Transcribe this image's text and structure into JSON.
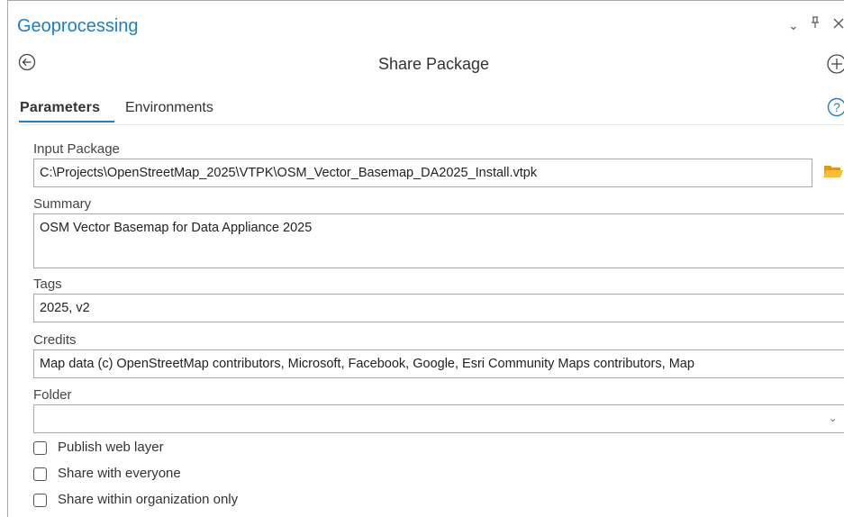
{
  "pane": {
    "title": "Geoprocessing",
    "window_controls": {
      "options_icon": "chevron-down-icon",
      "pin_icon": "pin-icon",
      "close_icon": "close-icon"
    }
  },
  "tool": {
    "title": "Share Package",
    "back_icon": "back-arrow-icon",
    "add_icon": "add-icon"
  },
  "tabs": [
    {
      "label": "Parameters",
      "active": true
    },
    {
      "label": "Environments",
      "active": false
    }
  ],
  "help_icon": "help-icon",
  "params": {
    "input_package": {
      "label": "Input Package",
      "value": "C:\\Projects\\OpenStreetMap_2025\\VTPK\\OSM_Vector_Basemap_DA2025_Install.vtpk",
      "browse_icon": "folder-icon"
    },
    "summary": {
      "label": "Summary",
      "value": "OSM Vector Basemap for Data Appliance 2025"
    },
    "tags": {
      "label": "Tags",
      "value": "2025, v2"
    },
    "credits": {
      "label": "Credits",
      "value": "Map data (c) OpenStreetMap contributors, Microsoft, Facebook, Google, Esri Community Maps contributors, Map"
    },
    "folder": {
      "label": "Folder",
      "value": ""
    }
  },
  "checkboxes": [
    {
      "label": "Publish web layer",
      "checked": false
    },
    {
      "label": "Share with everyone",
      "checked": false
    },
    {
      "label": "Share within organization only",
      "checked": false
    }
  ],
  "colors": {
    "accent": "#1f7ec2",
    "folder": "#f2b01e"
  }
}
